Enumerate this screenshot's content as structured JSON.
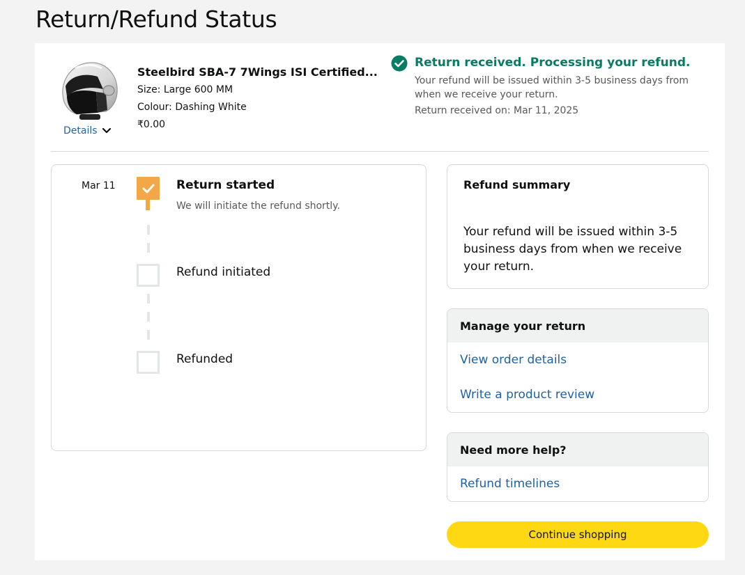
{
  "page": {
    "title": "Return/Refund Status"
  },
  "product": {
    "image_icon": "helmet-product-image",
    "details_label": "Details",
    "title": "Steelbird SBA-7 7Wings ISI Certified...",
    "size": "Size: Large 600 MM",
    "colour": "Colour: Dashing White",
    "price": "₹0.00"
  },
  "status": {
    "icon": "check-circle-icon",
    "title": "Return received. Processing your refund.",
    "description": "Your refund will be issued within 3-5 business days from when we receive your return.",
    "received_on": "Return received on: Mar 11, 2025",
    "color": "#067d62"
  },
  "timeline": {
    "steps": [
      {
        "date": "Mar 11",
        "label": "Return started",
        "sub": "We will initiate the refund shortly.",
        "done": true
      },
      {
        "date": "",
        "label": "Refund initiated",
        "sub": "",
        "done": false
      },
      {
        "date": "",
        "label": "Refunded",
        "sub": "",
        "done": false
      }
    ],
    "accent": "#f3a847"
  },
  "refund_summary": {
    "title": "Refund summary",
    "text": "Your refund will be issued within 3-5 business days from when we receive your return."
  },
  "manage": {
    "title": "Manage your return",
    "links": [
      "View order details",
      "Write a product review"
    ]
  },
  "help": {
    "title": "Need more help?",
    "links": [
      "Refund timelines"
    ]
  },
  "continue_button": {
    "label": "Continue shopping",
    "color": "#ffd814"
  }
}
